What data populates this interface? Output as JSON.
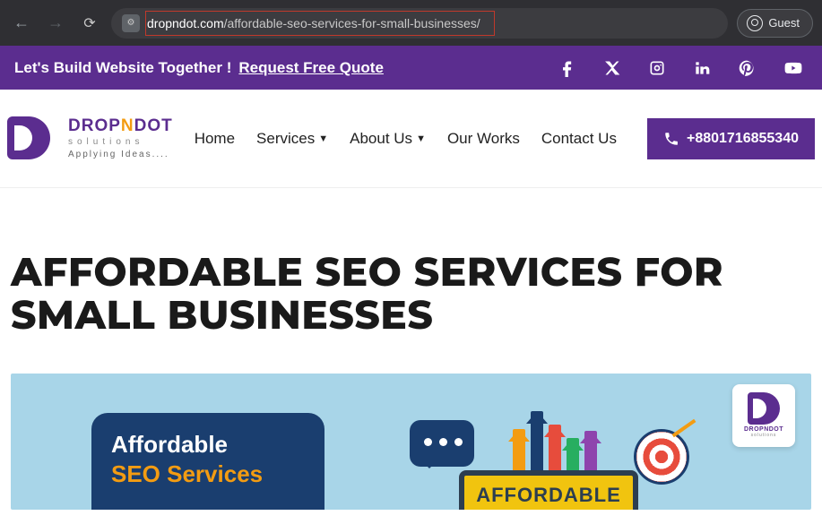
{
  "browser": {
    "url_domain": "dropndot.com",
    "url_path": "/affordable-seo-services-for-small-businesses/",
    "guest_label": "Guest"
  },
  "topbar": {
    "tagline": "Let's Build Website Together !",
    "cta": "Request Free Quote"
  },
  "logo": {
    "title_part1": "DROP",
    "title_n": "N",
    "title_part2": "DOT",
    "subtitle": "solutions",
    "tagline": "Applying Ideas...."
  },
  "nav": {
    "items": [
      "Home",
      "Services",
      "About Us",
      "Our Works",
      "Contact Us"
    ],
    "phone": "+8801716855340"
  },
  "page": {
    "title": "AFFORDABLE SEO SERVICES FOR SMALL BUSINESSES"
  },
  "hero": {
    "badge_title": "DROPNDOT",
    "badge_sub": "solutions",
    "card_line1": "Affordable",
    "card_line2": "SEO Services",
    "monitor_text": "AFFORDABLE"
  }
}
